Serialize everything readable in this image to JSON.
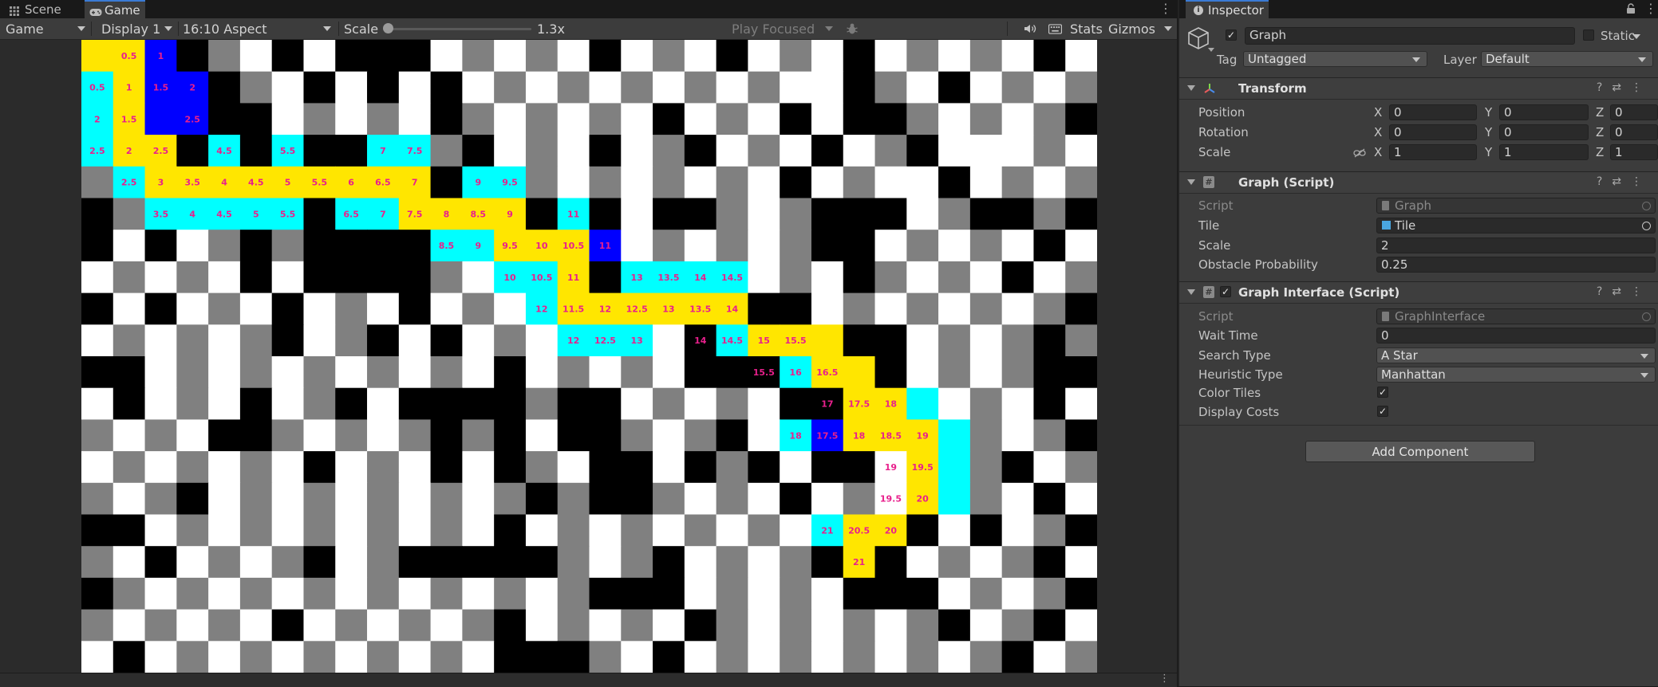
{
  "tabs": {
    "scene": "Scene",
    "game": "Game"
  },
  "toolbar": {
    "game_dropdown": "Game",
    "display": "Display 1",
    "aspect": "16:10 Aspect",
    "scale_label": "Scale",
    "scale_value": "1.3x",
    "play_mode": "Play Focused",
    "stats": "Stats",
    "gizmos": "Gizmos"
  },
  "inspector": {
    "tab_title": "Inspector",
    "object_name": "Graph",
    "static_label": "Static",
    "tag_label": "Tag",
    "tag_value": "Untagged",
    "layer_label": "Layer",
    "layer_value": "Default",
    "transform": {
      "title": "Transform",
      "position_label": "Position",
      "rotation_label": "Rotation",
      "scale_label": "Scale",
      "position": {
        "x": "0",
        "y": "0",
        "z": "0"
      },
      "rotation": {
        "x": "0",
        "y": "0",
        "z": "0"
      },
      "scale": {
        "x": "1",
        "y": "1",
        "z": "1"
      }
    },
    "graph_script": {
      "title": "Graph (Script)",
      "script_label": "Script",
      "script_value": "Graph",
      "tile_label": "Tile",
      "tile_value": "Tile",
      "scale_label": "Scale",
      "scale_value": "2",
      "obstacle_label": "Obstacle Probability",
      "obstacle_value": "0.25"
    },
    "graph_interface": {
      "title": "Graph Interface (Script)",
      "script_label": "Script",
      "script_value": "GraphInterface",
      "wait_label": "Wait Time",
      "wait_value": "0",
      "search_label": "Search Type",
      "search_value": "A Star",
      "heuristic_label": "Heuristic Type",
      "heuristic_value": "Manhattan",
      "color_tiles_label": "Color Tiles",
      "display_costs_label": "Display Costs"
    },
    "add_component": "Add Component"
  },
  "grid": {
    "colors": {
      "w": "#ffffff",
      "g": "#808080",
      "b": "#000000",
      "y": "#ffe600",
      "c": "#00ffff",
      "d": "#0000ff"
    },
    "text_color": "#e8208c",
    "rows": [
      [
        "y",
        "y",
        "d",
        "b",
        "g",
        "w",
        "b",
        "w",
        "b",
        "b",
        "b",
        "w",
        "g",
        "w",
        "g",
        "w",
        "b",
        "w",
        "g",
        "w",
        "b",
        "w",
        "g",
        "w",
        "b",
        "w",
        "g",
        "w",
        "g",
        "w",
        "b",
        "w"
      ],
      [
        "c",
        "y",
        "d",
        "d",
        "b",
        "g",
        "w",
        "b",
        "w",
        "b",
        "w",
        "b",
        "w",
        "g",
        "w",
        "g",
        "w",
        "g",
        "w",
        "g",
        "w",
        "g",
        "w",
        "w",
        "b",
        "g",
        "w",
        "b",
        "w",
        "g",
        "w",
        "g"
      ],
      [
        "c",
        "y",
        "d",
        "d",
        "b",
        "b",
        "w",
        "g",
        "w",
        "g",
        "w",
        "b",
        "g",
        "w",
        "g",
        "w",
        "g",
        "w",
        "b",
        "w",
        "g",
        "w",
        "b",
        "w",
        "b",
        "b",
        "g",
        "w",
        "g",
        "w",
        "g",
        "b"
      ],
      [
        "c",
        "y",
        "y",
        "b",
        "c",
        "b",
        "c",
        "b",
        "b",
        "c",
        "c",
        "g",
        "b",
        "w",
        "g",
        "w",
        "b",
        "w",
        "g",
        "b",
        "w",
        "g",
        "w",
        "b",
        "w",
        "g",
        "b",
        "w",
        "w",
        "w",
        "g",
        "w"
      ],
      [
        "g",
        "c",
        "y",
        "y",
        "y",
        "y",
        "y",
        "y",
        "y",
        "y",
        "y",
        "b",
        "c",
        "c",
        "g",
        "w",
        "g",
        "w",
        "g",
        "w",
        "g",
        "w",
        "b",
        "w",
        "g",
        "w",
        "w",
        "b",
        "w",
        "g",
        "w",
        "g"
      ],
      [
        "b",
        "g",
        "c",
        "c",
        "c",
        "c",
        "c",
        "b",
        "c",
        "c",
        "y",
        "y",
        "y",
        "y",
        "b",
        "c",
        "b",
        "w",
        "b",
        "b",
        "g",
        "w",
        "g",
        "b",
        "b",
        "b",
        "w",
        "g",
        "b",
        "b",
        "g",
        "b"
      ],
      [
        "b",
        "w",
        "b",
        "w",
        "g",
        "b",
        "g",
        "b",
        "b",
        "b",
        "b",
        "c",
        "c",
        "y",
        "y",
        "y",
        "d",
        "w",
        "g",
        "w",
        "g",
        "w",
        "g",
        "b",
        "b",
        "w",
        "g",
        "w",
        "g",
        "w",
        "b",
        "w"
      ],
      [
        "w",
        "g",
        "w",
        "g",
        "w",
        "b",
        "w",
        "b",
        "b",
        "b",
        "b",
        "g",
        "w",
        "c",
        "c",
        "y",
        "b",
        "c",
        "c",
        "c",
        "c",
        "w",
        "g",
        "w",
        "b",
        "g",
        "w",
        "g",
        "w",
        "b",
        "w",
        "g"
      ],
      [
        "b",
        "w",
        "b",
        "w",
        "g",
        "w",
        "b",
        "w",
        "g",
        "w",
        "b",
        "w",
        "g",
        "w",
        "c",
        "y",
        "y",
        "y",
        "y",
        "y",
        "y",
        "b",
        "b",
        "w",
        "g",
        "w",
        "g",
        "w",
        "g",
        "w",
        "g",
        "b"
      ],
      [
        "w",
        "g",
        "w",
        "g",
        "w",
        "g",
        "b",
        "w",
        "g",
        "b",
        "w",
        "b",
        "w",
        "g",
        "w",
        "c",
        "c",
        "c",
        "w",
        "b",
        "c",
        "y",
        "y",
        "y",
        "b",
        "b",
        "w",
        "g",
        "w",
        "g",
        "b",
        "g"
      ],
      [
        "b",
        "b",
        "w",
        "g",
        "w",
        "g",
        "w",
        "g",
        "w",
        "g",
        "w",
        "g",
        "w",
        "b",
        "w",
        "g",
        "w",
        "g",
        "w",
        "b",
        "b",
        "b",
        "c",
        "y",
        "y",
        "b",
        "w",
        "g",
        "w",
        "g",
        "b",
        "b"
      ],
      [
        "w",
        "b",
        "w",
        "g",
        "w",
        "b",
        "w",
        "g",
        "b",
        "w",
        "b",
        "b",
        "b",
        "b",
        "g",
        "b",
        "b",
        "w",
        "g",
        "w",
        "g",
        "w",
        "b",
        "b",
        "y",
        "y",
        "c",
        "w",
        "g",
        "w",
        "b",
        "w"
      ],
      [
        "g",
        "w",
        "g",
        "w",
        "b",
        "b",
        "g",
        "w",
        "g",
        "w",
        "g",
        "b",
        "g",
        "b",
        "w",
        "b",
        "b",
        "g",
        "w",
        "g",
        "b",
        "w",
        "c",
        "d",
        "y",
        "y",
        "y",
        "c",
        "g",
        "w",
        "g",
        "b"
      ],
      [
        "w",
        "g",
        "w",
        "g",
        "w",
        "g",
        "w",
        "b",
        "w",
        "g",
        "w",
        "b",
        "w",
        "b",
        "g",
        "w",
        "b",
        "b",
        "w",
        "b",
        "g",
        "b",
        "w",
        "b",
        "b",
        "w",
        "y",
        "c",
        "g",
        "b",
        "w",
        "g"
      ],
      [
        "g",
        "w",
        "g",
        "b",
        "w",
        "g",
        "w",
        "g",
        "w",
        "g",
        "w",
        "g",
        "w",
        "g",
        "b",
        "g",
        "b",
        "b",
        "g",
        "w",
        "g",
        "w",
        "b",
        "w",
        "g",
        "w",
        "y",
        "c",
        "g",
        "w",
        "b",
        "w"
      ],
      [
        "b",
        "b",
        "w",
        "g",
        "w",
        "g",
        "w",
        "g",
        "w",
        "g",
        "w",
        "g",
        "w",
        "b",
        "w",
        "g",
        "w",
        "g",
        "w",
        "g",
        "w",
        "g",
        "w",
        "c",
        "y",
        "y",
        "b",
        "w",
        "b",
        "w",
        "g",
        "b"
      ],
      [
        "g",
        "w",
        "b",
        "w",
        "g",
        "w",
        "g",
        "b",
        "w",
        "g",
        "b",
        "b",
        "b",
        "b",
        "b",
        "g",
        "w",
        "g",
        "b",
        "w",
        "g",
        "w",
        "g",
        "b",
        "y",
        "b",
        "w",
        "g",
        "w",
        "g",
        "b",
        "w"
      ],
      [
        "b",
        "g",
        "w",
        "g",
        "w",
        "g",
        "w",
        "g",
        "w",
        "g",
        "w",
        "g",
        "w",
        "g",
        "w",
        "g",
        "b",
        "b",
        "b",
        "w",
        "g",
        "w",
        "g",
        "w",
        "b",
        "b",
        "b",
        "w",
        "g",
        "w",
        "g",
        "b"
      ],
      [
        "g",
        "w",
        "g",
        "w",
        "g",
        "w",
        "b",
        "w",
        "g",
        "w",
        "g",
        "w",
        "g",
        "b",
        "w",
        "g",
        "w",
        "g",
        "w",
        "b",
        "g",
        "w",
        "g",
        "w",
        "g",
        "w",
        "g",
        "b",
        "w",
        "g",
        "b",
        "w"
      ],
      [
        "w",
        "b",
        "w",
        "g",
        "w",
        "g",
        "w",
        "g",
        "w",
        "g",
        "w",
        "g",
        "w",
        "b",
        "b",
        "b",
        "g",
        "w",
        "b",
        "w",
        "g",
        "w",
        "g",
        "w",
        "g",
        "w",
        "g",
        "w",
        "g",
        "b",
        "w",
        "g"
      ]
    ],
    "labels": [
      {
        "r": 0,
        "c": 1,
        "t": "0.5"
      },
      {
        "r": 0,
        "c": 2,
        "t": "1"
      },
      {
        "r": 1,
        "c": 0,
        "t": "0.5"
      },
      {
        "r": 1,
        "c": 1,
        "t": "1"
      },
      {
        "r": 1,
        "c": 2,
        "t": "1.5"
      },
      {
        "r": 1,
        "c": 3,
        "t": "2"
      },
      {
        "r": 2,
        "c": 0,
        "t": "2"
      },
      {
        "r": 2,
        "c": 1,
        "t": "1.5"
      },
      {
        "r": 2,
        "c": 3,
        "t": "2.5"
      },
      {
        "r": 3,
        "c": 0,
        "t": "2.5"
      },
      {
        "r": 3,
        "c": 1,
        "t": "2"
      },
      {
        "r": 3,
        "c": 2,
        "t": "2.5"
      },
      {
        "r": 3,
        "c": 4,
        "t": "4.5"
      },
      {
        "r": 3,
        "c": 6,
        "t": "5.5"
      },
      {
        "r": 3,
        "c": 9,
        "t": "7"
      },
      {
        "r": 3,
        "c": 10,
        "t": "7.5"
      },
      {
        "r": 4,
        "c": 1,
        "t": "2.5"
      },
      {
        "r": 4,
        "c": 2,
        "t": "3"
      },
      {
        "r": 4,
        "c": 3,
        "t": "3.5"
      },
      {
        "r": 4,
        "c": 4,
        "t": "4"
      },
      {
        "r": 4,
        "c": 5,
        "t": "4.5"
      },
      {
        "r": 4,
        "c": 6,
        "t": "5"
      },
      {
        "r": 4,
        "c": 7,
        "t": "5.5"
      },
      {
        "r": 4,
        "c": 8,
        "t": "6"
      },
      {
        "r": 4,
        "c": 9,
        "t": "6.5"
      },
      {
        "r": 4,
        "c": 10,
        "t": "7"
      },
      {
        "r": 4,
        "c": 12,
        "t": "9"
      },
      {
        "r": 4,
        "c": 13,
        "t": "9.5"
      },
      {
        "r": 5,
        "c": 2,
        "t": "3.5"
      },
      {
        "r": 5,
        "c": 3,
        "t": "4"
      },
      {
        "r": 5,
        "c": 4,
        "t": "4.5"
      },
      {
        "r": 5,
        "c": 5,
        "t": "5"
      },
      {
        "r": 5,
        "c": 6,
        "t": "5.5"
      },
      {
        "r": 5,
        "c": 8,
        "t": "6.5"
      },
      {
        "r": 5,
        "c": 9,
        "t": "7"
      },
      {
        "r": 5,
        "c": 10,
        "t": "7.5"
      },
      {
        "r": 5,
        "c": 11,
        "t": "8"
      },
      {
        "r": 5,
        "c": 12,
        "t": "8.5"
      },
      {
        "r": 5,
        "c": 13,
        "t": "9"
      },
      {
        "r": 5,
        "c": 15,
        "t": "11"
      },
      {
        "r": 6,
        "c": 11,
        "t": "8.5"
      },
      {
        "r": 6,
        "c": 12,
        "t": "9"
      },
      {
        "r": 6,
        "c": 13,
        "t": "9.5"
      },
      {
        "r": 6,
        "c": 14,
        "t": "10"
      },
      {
        "r": 6,
        "c": 15,
        "t": "10.5"
      },
      {
        "r": 6,
        "c": 16,
        "t": "11"
      },
      {
        "r": 7,
        "c": 13,
        "t": "10"
      },
      {
        "r": 7,
        "c": 14,
        "t": "10.5"
      },
      {
        "r": 7,
        "c": 15,
        "t": "11"
      },
      {
        "r": 7,
        "c": 17,
        "t": "13"
      },
      {
        "r": 7,
        "c": 18,
        "t": "13.5"
      },
      {
        "r": 7,
        "c": 19,
        "t": "14"
      },
      {
        "r": 7,
        "c": 20,
        "t": "14.5"
      },
      {
        "r": 8,
        "c": 14,
        "t": "12"
      },
      {
        "r": 8,
        "c": 15,
        "t": "11.5"
      },
      {
        "r": 8,
        "c": 16,
        "t": "12"
      },
      {
        "r": 8,
        "c": 17,
        "t": "12.5"
      },
      {
        "r": 8,
        "c": 18,
        "t": "13"
      },
      {
        "r": 8,
        "c": 19,
        "t": "13.5"
      },
      {
        "r": 8,
        "c": 20,
        "t": "14"
      },
      {
        "r": 9,
        "c": 15,
        "t": "12"
      },
      {
        "r": 9,
        "c": 16,
        "t": "12.5"
      },
      {
        "r": 9,
        "c": 17,
        "t": "13"
      },
      {
        "r": 9,
        "c": 19,
        "t": "14"
      },
      {
        "r": 9,
        "c": 20,
        "t": "14.5"
      },
      {
        "r": 9,
        "c": 21,
        "t": "15"
      },
      {
        "r": 9,
        "c": 22,
        "t": "15.5"
      },
      {
        "r": 10,
        "c": 21,
        "t": "15.5"
      },
      {
        "r": 10,
        "c": 22,
        "t": "16"
      },
      {
        "r": 10,
        "c": 23,
        "t": "16.5"
      },
      {
        "r": 11,
        "c": 23,
        "t": "17"
      },
      {
        "r": 11,
        "c": 24,
        "t": "17.5"
      },
      {
        "r": 11,
        "c": 25,
        "t": "18"
      },
      {
        "r": 12,
        "c": 22,
        "t": "18"
      },
      {
        "r": 12,
        "c": 23,
        "t": "17.5"
      },
      {
        "r": 12,
        "c": 24,
        "t": "18"
      },
      {
        "r": 12,
        "c": 25,
        "t": "18.5"
      },
      {
        "r": 12,
        "c": 26,
        "t": "19"
      },
      {
        "r": 13,
        "c": 25,
        "t": "19"
      },
      {
        "r": 13,
        "c": 26,
        "t": "19.5"
      },
      {
        "r": 14,
        "c": 25,
        "t": "19.5"
      },
      {
        "r": 14,
        "c": 26,
        "t": "20"
      },
      {
        "r": 15,
        "c": 23,
        "t": "21"
      },
      {
        "r": 15,
        "c": 24,
        "t": "20.5"
      },
      {
        "r": 15,
        "c": 25,
        "t": "20"
      },
      {
        "r": 16,
        "c": 24,
        "t": "21"
      }
    ]
  }
}
